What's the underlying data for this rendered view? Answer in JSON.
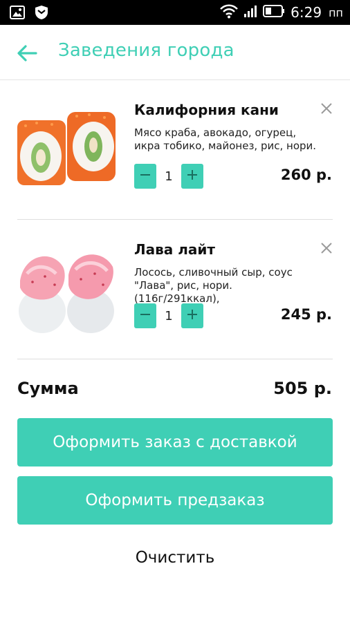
{
  "status_bar": {
    "time": "6:29",
    "time_suffix": "пп",
    "icons": [
      "image-icon",
      "shield-icon",
      "wifi-icon",
      "signal-icon",
      "battery-icon"
    ]
  },
  "app_bar": {
    "title": "Заведения города",
    "back_icon": "arrow-left-icon",
    "accent_color": "#3fcfb5"
  },
  "cart": {
    "items": [
      {
        "name": "Калифорния кани",
        "description": "Мясо краба, авокадо, огурец, икра тобико, майонез, рис, нори.",
        "quantity": "1",
        "price": "260 р."
      },
      {
        "name": "Лава лайт",
        "description": "Лосось, сливочный сыр, соус \"Лава\", рис, нори. (116г/291ккал),",
        "quantity": "1",
        "price": "245 р."
      }
    ]
  },
  "summary": {
    "label": "Сумма",
    "value": "505 р."
  },
  "actions": {
    "delivery_order": "Оформить заказ с доставкой",
    "pre_order": "Оформить предзаказ",
    "clear": "Очистить"
  }
}
